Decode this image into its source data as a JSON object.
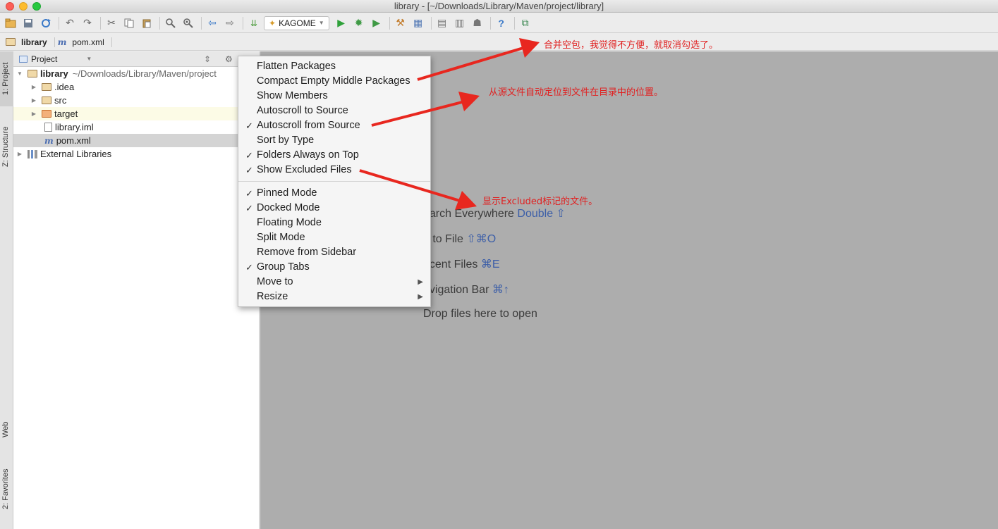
{
  "window": {
    "title": "library - [~/Downloads/Library/Maven/project/library]"
  },
  "toolbar": {
    "run_config": "KAGOME",
    "icons": [
      "open-folder-icon",
      "save-icon",
      "sync-icon",
      "undo-icon",
      "redo-icon",
      "cut-icon",
      "copy-icon",
      "paste-icon",
      "find-icon",
      "replace-icon",
      "back-icon",
      "forward-icon",
      "build-icon",
      "run-config-select",
      "run-icon",
      "debug-icon",
      "coverage-icon",
      "settings-icon",
      "structure-icon",
      "sdk-icon",
      "android-device-icon",
      "android-icon",
      "help-icon",
      "vcs-icon"
    ]
  },
  "navbar": {
    "crumbs": [
      "library",
      "pom.xml"
    ]
  },
  "stripe": {
    "project_tab": "1: Project",
    "structure_tab": "Z: Structure",
    "web_tab": "Web",
    "favorites_tab": "2: Favorites"
  },
  "project_panel": {
    "title": "Project",
    "tree": {
      "root_name": "library",
      "root_path": "~/Downloads/Library/Maven/project",
      "idea": ".idea",
      "src": "src",
      "target": "target",
      "iml": "library.iml",
      "pom": "pom.xml",
      "external": "External Libraries"
    }
  },
  "menu": {
    "group1": [
      {
        "label": "Flatten Packages",
        "checked": false
      },
      {
        "label": "Compact Empty Middle Packages",
        "checked": false
      },
      {
        "label": "Show Members",
        "checked": false
      },
      {
        "label": "Autoscroll to Source",
        "checked": false
      },
      {
        "label": "Autoscroll from Source",
        "checked": true
      },
      {
        "label": "Sort by Type",
        "checked": false
      },
      {
        "label": "Folders Always on Top",
        "checked": true
      },
      {
        "label": "Show Excluded Files",
        "checked": true
      }
    ],
    "group2": [
      {
        "label": "Pinned Mode",
        "checked": true
      },
      {
        "label": "Docked Mode",
        "checked": true
      },
      {
        "label": "Floating Mode",
        "checked": false
      },
      {
        "label": "Split Mode",
        "checked": false
      },
      {
        "label": "Remove from Sidebar",
        "checked": false
      },
      {
        "label": "Group Tabs",
        "checked": true
      },
      {
        "label": "Move to",
        "checked": false,
        "submenu": true
      },
      {
        "label": "Resize",
        "checked": false,
        "submenu": true
      }
    ]
  },
  "editor_hints": {
    "search_text": "earch Everywhere",
    "search_key": "Double ⇧",
    "goto_text": "o to File",
    "goto_key": "⇧⌘O",
    "recent_text": "ecent Files",
    "recent_key": "⌘E",
    "nav_text": "avigation Bar",
    "nav_key": "⌘↑",
    "drop_text": "Drop files here to open"
  },
  "annotations": {
    "compact": "合并空包，我觉得不方便，就取消勾选了。",
    "autoscroll": "从源文件自动定位到文件在目录中的位置。",
    "excluded": "显示Excluded标记的文件。"
  },
  "colors": {
    "annotation_red": "#e02020",
    "editor_bg": "#adadad",
    "shortcut_blue": "#3d5fa8"
  }
}
